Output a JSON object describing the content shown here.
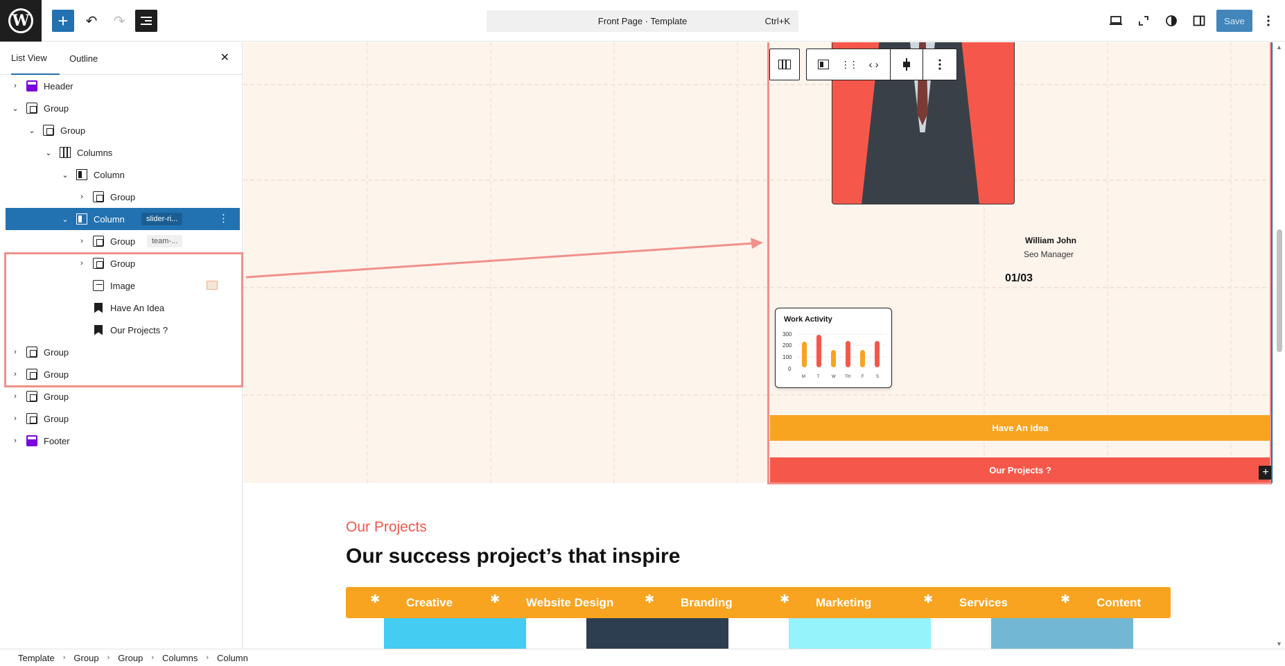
{
  "topbar": {
    "logo": "W",
    "add_icon": "+",
    "undo_icon": "↶",
    "redo_icon": "↷",
    "command_title": "Front Page · Template",
    "command_shortcut": "Ctrl+K",
    "save_label": "Save"
  },
  "sidebar": {
    "tabs": [
      "List View",
      "Outline"
    ],
    "close_icon": "✕",
    "items": [
      {
        "label": "Header",
        "icon": "template-part-icon",
        "chev": "›",
        "tag": ""
      },
      {
        "label": "Group",
        "icon": "group-icon",
        "chev": "⌄",
        "tag": ""
      },
      {
        "label": "Group",
        "icon": "group-icon",
        "chev": "⌄",
        "tag": ""
      },
      {
        "label": "Columns",
        "icon": "columns-icon",
        "chev": "⌄",
        "tag": ""
      },
      {
        "label": "Column",
        "icon": "column-icon",
        "chev": "⌄",
        "tag": ""
      },
      {
        "label": "Group",
        "icon": "group-icon",
        "chev": "›",
        "tag": ""
      },
      {
        "label": "Column",
        "icon": "column-icon",
        "chev": "⌄",
        "tag": "slider-ri..."
      },
      {
        "label": "Group",
        "icon": "group-icon",
        "chev": "›",
        "tag": "team-..."
      },
      {
        "label": "Group",
        "icon": "group-icon",
        "chev": "›",
        "tag": ""
      },
      {
        "label": "Image",
        "icon": "image-icon",
        "chev": "",
        "tag": ""
      },
      {
        "label": "Have An Idea",
        "icon": "bookmark-icon",
        "chev": "",
        "tag": ""
      },
      {
        "label": "Our Projects ?",
        "icon": "bookmark-icon",
        "chev": "",
        "tag": ""
      },
      {
        "label": "Group",
        "icon": "group-icon",
        "chev": "›",
        "tag": ""
      },
      {
        "label": "Group",
        "icon": "group-icon",
        "chev": "›",
        "tag": ""
      },
      {
        "label": "Group",
        "icon": "group-icon",
        "chev": "›",
        "tag": ""
      },
      {
        "label": "Group",
        "icon": "group-icon",
        "chev": "›",
        "tag": ""
      },
      {
        "label": "Footer",
        "icon": "template-part-icon",
        "chev": "›",
        "tag": ""
      }
    ]
  },
  "canvas": {
    "person_name": "William John",
    "person_role": "Seo Manager",
    "counter": "01/03",
    "activity": {
      "title": "Work Activity",
      "y_ticks": [
        "300",
        "200",
        "100",
        "0"
      ],
      "days": [
        "M",
        "T",
        "W",
        "TH",
        "F",
        "S"
      ]
    },
    "have_idea": "Have An Idea",
    "our_projects": "Our Projects ?",
    "projects_kicker": "Our Projects",
    "projects_heading": "Our success project’s that inspire",
    "categories": [
      "Creative",
      "Website Design",
      "Branding",
      "Marketing",
      "Services",
      "Content"
    ],
    "star": "✱",
    "colors": {
      "hero_bg": "#fdf4ec",
      "accent_red": "#f5584a",
      "accent_orange": "#f8a420",
      "wp_blue": "#2271b1",
      "tile_colors": [
        "#44ccf2",
        "#2d3e50",
        "#94f3fb",
        "#72b8d4"
      ]
    }
  },
  "breadcrumbs": [
    "Template",
    "Group",
    "Group",
    "Columns",
    "Column"
  ]
}
